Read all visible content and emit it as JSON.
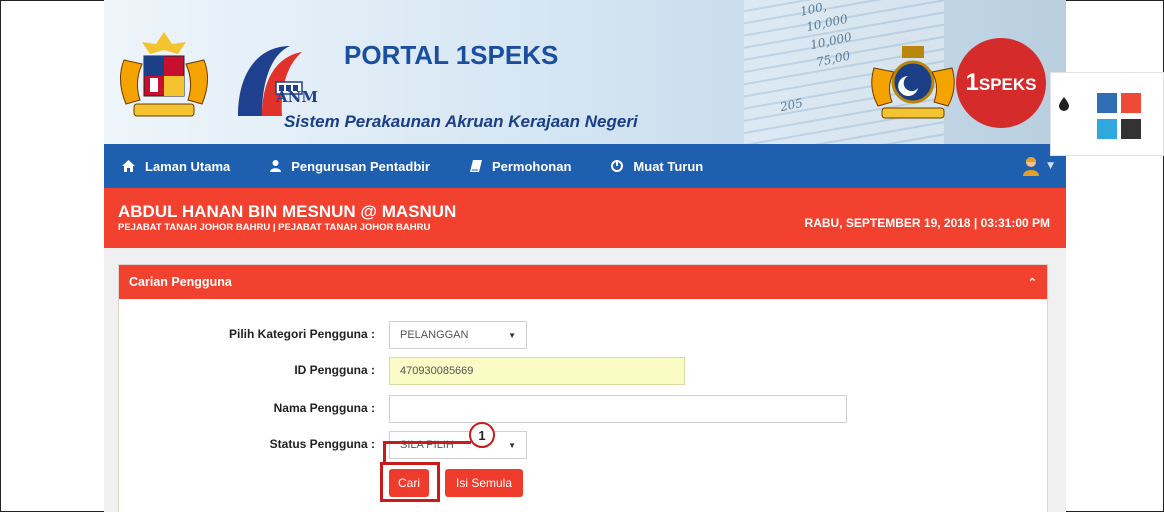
{
  "header": {
    "title": "PORTAL 1SPEKS",
    "subtitle": "Sistem Perakaunan Akruan Kerajaan Negeri",
    "anm_label": "ANM",
    "brand_prefix": "1",
    "brand_suffix": "SPEKS",
    "sheet_numbers": [
      "100,",
      "10,000",
      "10,000",
      "75,00",
      "205"
    ]
  },
  "nav": {
    "items": [
      {
        "label": "Laman Utama",
        "icon": "home-icon"
      },
      {
        "label": "Pengurusan Pentadbir",
        "icon": "user-icon"
      },
      {
        "label": "Permohonan",
        "icon": "book-icon"
      },
      {
        "label": "Muat Turun",
        "icon": "power-icon"
      }
    ],
    "user_menu_icon": "avatar-icon"
  },
  "userbar": {
    "name": "ABDUL HANAN BIN MESNUN @ MASNUN",
    "office": "PEJABAT TANAH JOHOR BAHRU | PEJABAT TANAH JOHOR BAHRU",
    "datetime": "RABU, SEPTEMBER 19, 2018 | 03:31:00 PM"
  },
  "panel": {
    "title": "Carian Pengguna",
    "collapse_icon": "chevron-up-icon",
    "fields": {
      "kategori_label": "Pilih Kategori Pengguna :",
      "kategori_value": "PELANGGAN",
      "id_label": "ID Pengguna :",
      "id_value": "470930085669",
      "nama_label": "Nama Pengguna :",
      "nama_value": "",
      "status_label": "Status Pengguna :",
      "status_value": "SILA PILIH"
    },
    "buttons": {
      "search": "Cari",
      "reset": "Isi Semula"
    }
  },
  "callout": {
    "number": "1"
  },
  "theme_widget": {
    "colors": [
      "#2f6db5",
      "#ef4a37",
      "#2fa8e0",
      "#333333"
    ]
  },
  "colors": {
    "nav_blue": "#1f5fb0",
    "accent_red": "#f2412f",
    "highlight_input": "#fbfbc6"
  }
}
